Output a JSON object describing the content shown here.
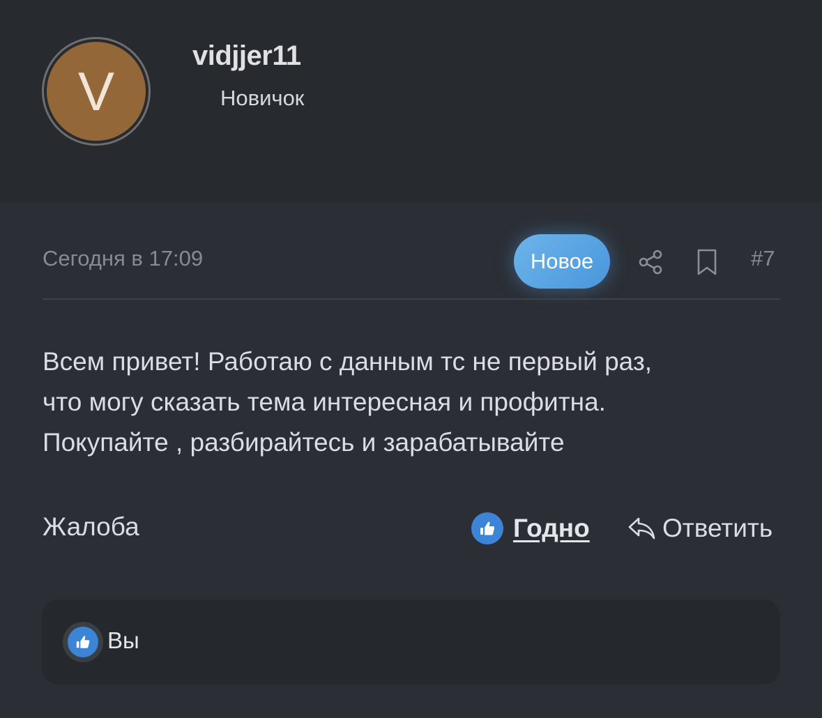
{
  "author": {
    "avatar_letter": "V",
    "username": "vidjjer11",
    "title": "Новичок"
  },
  "post": {
    "date": "Сегодня в 17:09",
    "new_badge": "Новое",
    "number": "#7",
    "body_lines": [
      "Всем привет! Работаю с данным тс не первый раз,",
      "что могу сказать тема интересная и профитна.",
      "Покупайте , разбирайтесь и зарабатывайте"
    ]
  },
  "actions": {
    "report": "Жалоба",
    "like": "Годно",
    "reply": "Ответить"
  },
  "reactions": {
    "user": "Вы"
  },
  "colors": {
    "background": "#2b2e34",
    "header_background": "#272a2f",
    "avatar": "#946739",
    "accent": "#4a96dc",
    "like": "#3c84d6"
  },
  "icons": {
    "share": "share-icon",
    "bookmark": "bookmark-icon",
    "like": "thumbs-up-icon",
    "reply": "reply-icon"
  }
}
